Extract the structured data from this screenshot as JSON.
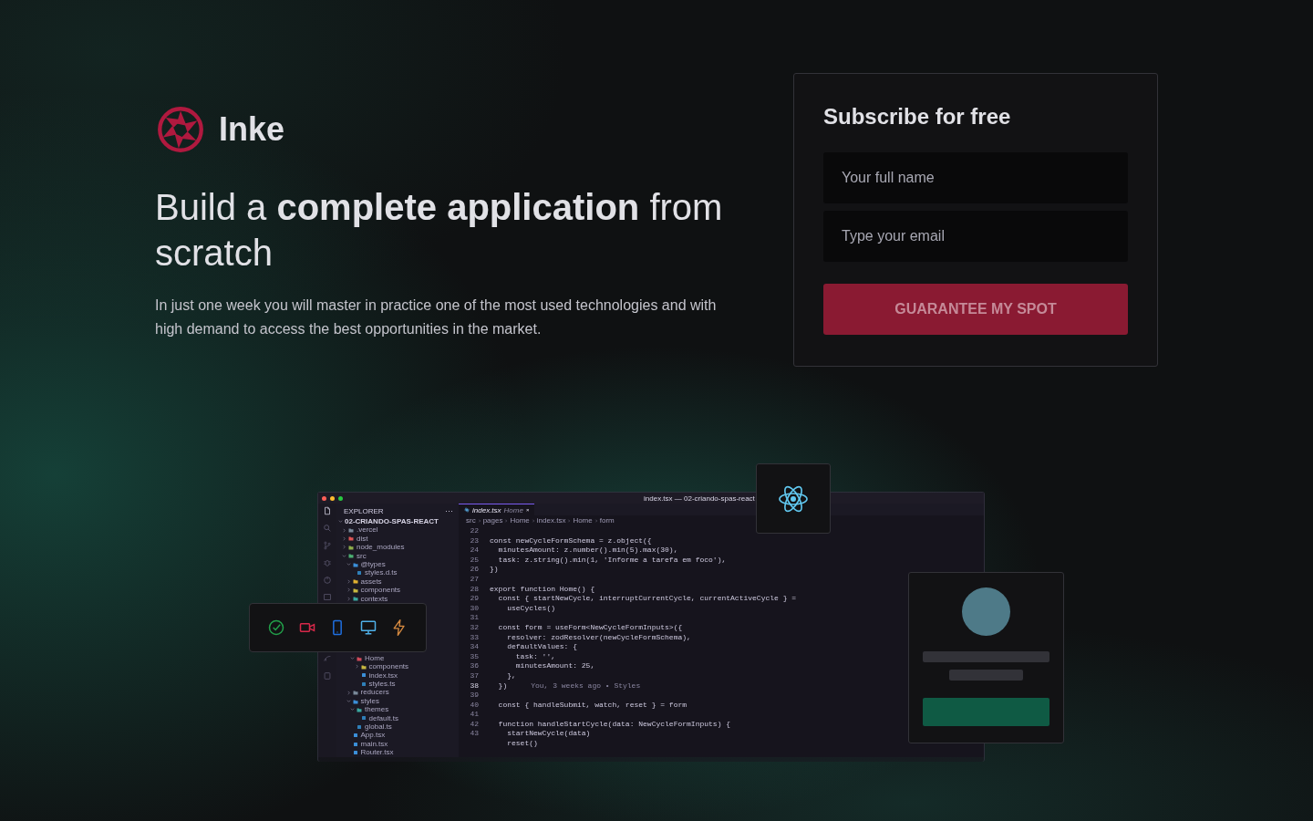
{
  "brand": {
    "name": "Inke"
  },
  "hero": {
    "title": "Build a **complete application** from scratch",
    "description": "In just one week you will master in practice one of the most used technologies and with high demand to access the best opportunities in the market."
  },
  "subscribe": {
    "title": "Subscribe for free",
    "fields": [
      {
        "placeholder": "Your full name"
      },
      {
        "placeholder": "Type your email"
      }
    ],
    "button": "GUARANTEE MY SPOT"
  },
  "editor": {
    "window_title": "index.tsx — 02-criando-spas-react",
    "explorer": {
      "title": "EXPLORER",
      "more": "···",
      "project": "02-CRIANDO-SPAS-REACT",
      "expanded": true,
      "tree_top": [
        {
          "label": ".vercel",
          "kind": "folder",
          "expanded": false,
          "color": "#7a8a9a"
        },
        {
          "label": "dist",
          "kind": "folder",
          "expanded": false,
          "color": "#e05555"
        },
        {
          "label": "node_modules",
          "kind": "folder",
          "expanded": false,
          "color": "#8fae4a"
        },
        {
          "label": "src",
          "kind": "folder",
          "expanded": true,
          "color": "#4caf72",
          "children": [
            {
              "label": "@types",
              "kind": "folder",
              "expanded": true,
              "color": "#3b8fd9",
              "children": [
                {
                  "label": "styles.d.ts",
                  "kind": "file",
                  "color": "#2f7fb8"
                }
              ]
            },
            {
              "label": "assets",
              "kind": "folder",
              "expanded": false,
              "color": "#e0b030"
            },
            {
              "label": "components",
              "kind": "folder",
              "expanded": false,
              "color": "#c8b840"
            },
            {
              "label": "contexts",
              "kind": "folder",
              "expanded": false,
              "color": "#3aa8a0"
            }
          ]
        }
      ],
      "tree_pages": [
        {
          "label": "Home",
          "kind": "folder",
          "expanded": true,
          "color": "#d04a5a",
          "children": [
            {
              "label": "components",
              "kind": "folder",
              "expanded": false,
              "color": "#c8b840"
            },
            {
              "label": "index.tsx",
              "kind": "file",
              "color": "#3b8fd9"
            },
            {
              "label": "styles.ts",
              "kind": "file",
              "color": "#2f7fb8"
            }
          ]
        }
      ],
      "tree_rest": [
        {
          "label": "reducers",
          "kind": "folder",
          "expanded": false,
          "color": "#7a8a9a"
        },
        {
          "label": "styles",
          "kind": "folder",
          "expanded": true,
          "color": "#3b8fd9",
          "children": [
            {
              "label": "themes",
              "kind": "folder",
              "expanded": true,
              "color": "#3aa8a0",
              "children": [
                {
                  "label": "default.ts",
                  "kind": "file",
                  "color": "#2f7fb8"
                }
              ]
            },
            {
              "label": "global.ts",
              "kind": "file",
              "color": "#2f7fb8"
            }
          ]
        },
        {
          "label": "App.tsx",
          "kind": "file",
          "color": "#3b8fd9"
        },
        {
          "label": "main.tsx",
          "kind": "file",
          "color": "#3b8fd9"
        },
        {
          "label": "Router.tsx",
          "kind": "file",
          "color": "#3b8fd9"
        }
      ]
    },
    "tabs": [
      {
        "label": "index.tsx",
        "detail": "Home",
        "close": "×",
        "selected": true
      }
    ],
    "breadcrumb": [
      "src",
      "pages",
      "Home",
      "index.tsx",
      "Home",
      "form"
    ],
    "code": [
      {
        "number": "22"
      },
      {
        "number": "23",
        "text": "const newCycleFormSchema = z.object({"
      },
      {
        "number": "24",
        "text": "  minutesAmount: z.number().min(5).max(30),"
      },
      {
        "number": "25",
        "text": "  task: z.string().min(1, 'Informe a tarefa em foco'),"
      },
      {
        "number": "26",
        "text": "})"
      },
      {
        "number": "27"
      },
      {
        "number": "28",
        "text": "export function Home() {"
      },
      {
        "number": "29",
        "text": "  const { startNewCycle, interruptCurrentCycle, currentActiveCycle } ="
      },
      {
        "number": "30",
        "text": "    useCycles()"
      },
      {
        "number": "31"
      },
      {
        "number": "32",
        "text": "  const form = useForm<NewCycleFormInputs>({"
      },
      {
        "number": "33",
        "text": "    resolver: zodResolver(newCycleFormSchema),"
      },
      {
        "number": "34",
        "text": "    defaultValues: {"
      },
      {
        "number": "35",
        "text": "      task: '',"
      },
      {
        "number": "36",
        "text": "      minutesAmount: 25,"
      },
      {
        "number": "37",
        "text": "    },"
      },
      {
        "number": "38",
        "text": "  })",
        "current": true,
        "blame": "You, 3 weeks ago • Styles"
      },
      {
        "number": "39"
      },
      {
        "number": "40",
        "text": "  const { handleSubmit, watch, reset } = form"
      },
      {
        "number": "41"
      },
      {
        "number": "42",
        "text": "  function handleStartCycle(data: NewCycleFormInputs) {"
      },
      {
        "number": "43",
        "text": "    startNewCycle(data)"
      },
      {
        "text": "    reset()"
      }
    ]
  }
}
